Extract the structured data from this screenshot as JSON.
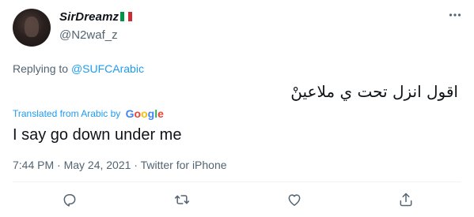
{
  "author": {
    "display_name": "SirDreamz",
    "handle": "@N2waf_z",
    "flag_colors": [
      "#009246",
      "#ffffff",
      "#ce2b37"
    ]
  },
  "reply": {
    "prefix": "Replying to",
    "mention": "@SUFCArabic"
  },
  "tweet": {
    "original_text": "اقول انزل تحت ي ملاعينْ",
    "translated_label": "Translated from Arabic by",
    "google_letters": [
      "G",
      "o",
      "o",
      "g",
      "l",
      "e"
    ],
    "google_colors": [
      "#4285f4",
      "#ea4335",
      "#fbbc05",
      "#4285f4",
      "#34a853",
      "#ea4335"
    ],
    "translation_text": "I say go down under me",
    "meta": "7:44 PM · May 24, 2021 · Twitter for iPhone"
  },
  "icons": {
    "more": "more-icon",
    "reply": "reply-icon",
    "retweet": "retweet-icon",
    "like": "like-icon",
    "share": "share-icon"
  },
  "colors": {
    "text": "#0f1419",
    "secondary": "#536471",
    "link": "#1d9bf0",
    "divider": "#eff3f4"
  }
}
